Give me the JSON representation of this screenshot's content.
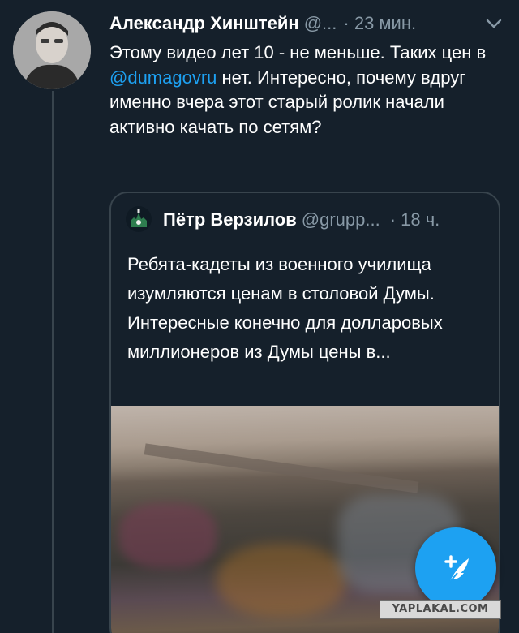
{
  "tweet": {
    "author_name": "Александр Хинштейн",
    "author_handle": "@...",
    "time": "· 23 мин.",
    "text_before": "Этому видео лет 10 - не меньше. Таких цен в ",
    "mention": "@dumagovru",
    "text_after": " нет. Интересно, почему вдруг именно вчера этот старый ролик начали активно качать по сетям?",
    "menu_icon": "chevron-down-icon"
  },
  "quoted": {
    "author_name": "Пётр Верзилов",
    "author_handle": "@grupp...",
    "time": "· 18 ч.",
    "text": "Ребята-кадеты из военного училища изумляются ценам в столовой Думы. Интересные конечно для долларовых миллионеров из Думы цены в...",
    "media": "video-preview"
  },
  "compose_button": {
    "icon": "compose-feather-icon"
  },
  "watermark": {
    "text": "YAPLAKAL.COM"
  },
  "colors": {
    "background": "#15202b",
    "accent": "#1da1f2",
    "secondary_text": "#8899a6",
    "border": "#38444d"
  }
}
